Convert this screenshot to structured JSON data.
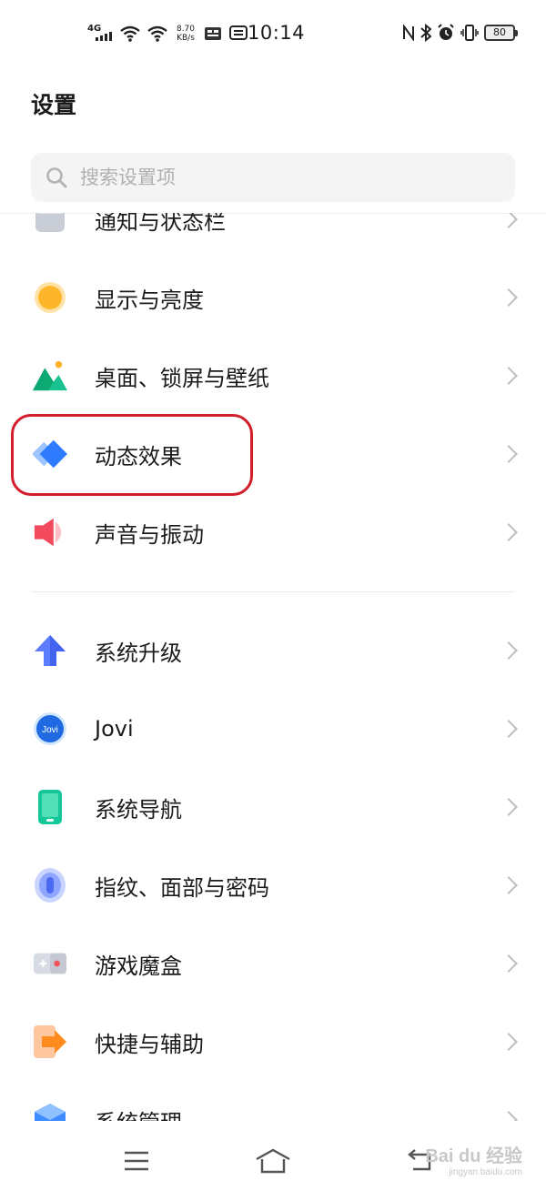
{
  "status_bar": {
    "network": "4G",
    "speed_value": "8.70",
    "speed_unit": "KB/s",
    "time": "10:14",
    "battery": "80"
  },
  "header": {
    "title": "设置",
    "search_placeholder": "搜索设置项"
  },
  "list": {
    "items": [
      {
        "label": "通知与状态栏",
        "icon": "notification-icon"
      },
      {
        "label": "显示与亮度",
        "icon": "brightness-icon"
      },
      {
        "label": "桌面、锁屏与壁纸",
        "icon": "wallpaper-icon"
      },
      {
        "label": "动态效果",
        "icon": "animation-icon"
      },
      {
        "label": "声音与振动",
        "icon": "sound-icon"
      },
      {
        "label": "系统升级",
        "icon": "upgrade-icon"
      },
      {
        "label": "Jovi",
        "icon": "jovi-icon",
        "icon_text": "Jovi"
      },
      {
        "label": "系统导航",
        "icon": "navigation-icon"
      },
      {
        "label": "指纹、面部与密码",
        "icon": "fingerprint-icon"
      },
      {
        "label": "游戏魔盒",
        "icon": "game-box-icon"
      },
      {
        "label": "快捷与辅助",
        "icon": "shortcut-icon"
      },
      {
        "label": "系统管理",
        "icon": "system-manage-icon"
      }
    ]
  },
  "watermark": {
    "main": "Bai du 经验",
    "sub": "jingyan.baidu.com"
  },
  "colors": {
    "highlight": "#d21d2a",
    "chevron": "#bdbdbd"
  }
}
